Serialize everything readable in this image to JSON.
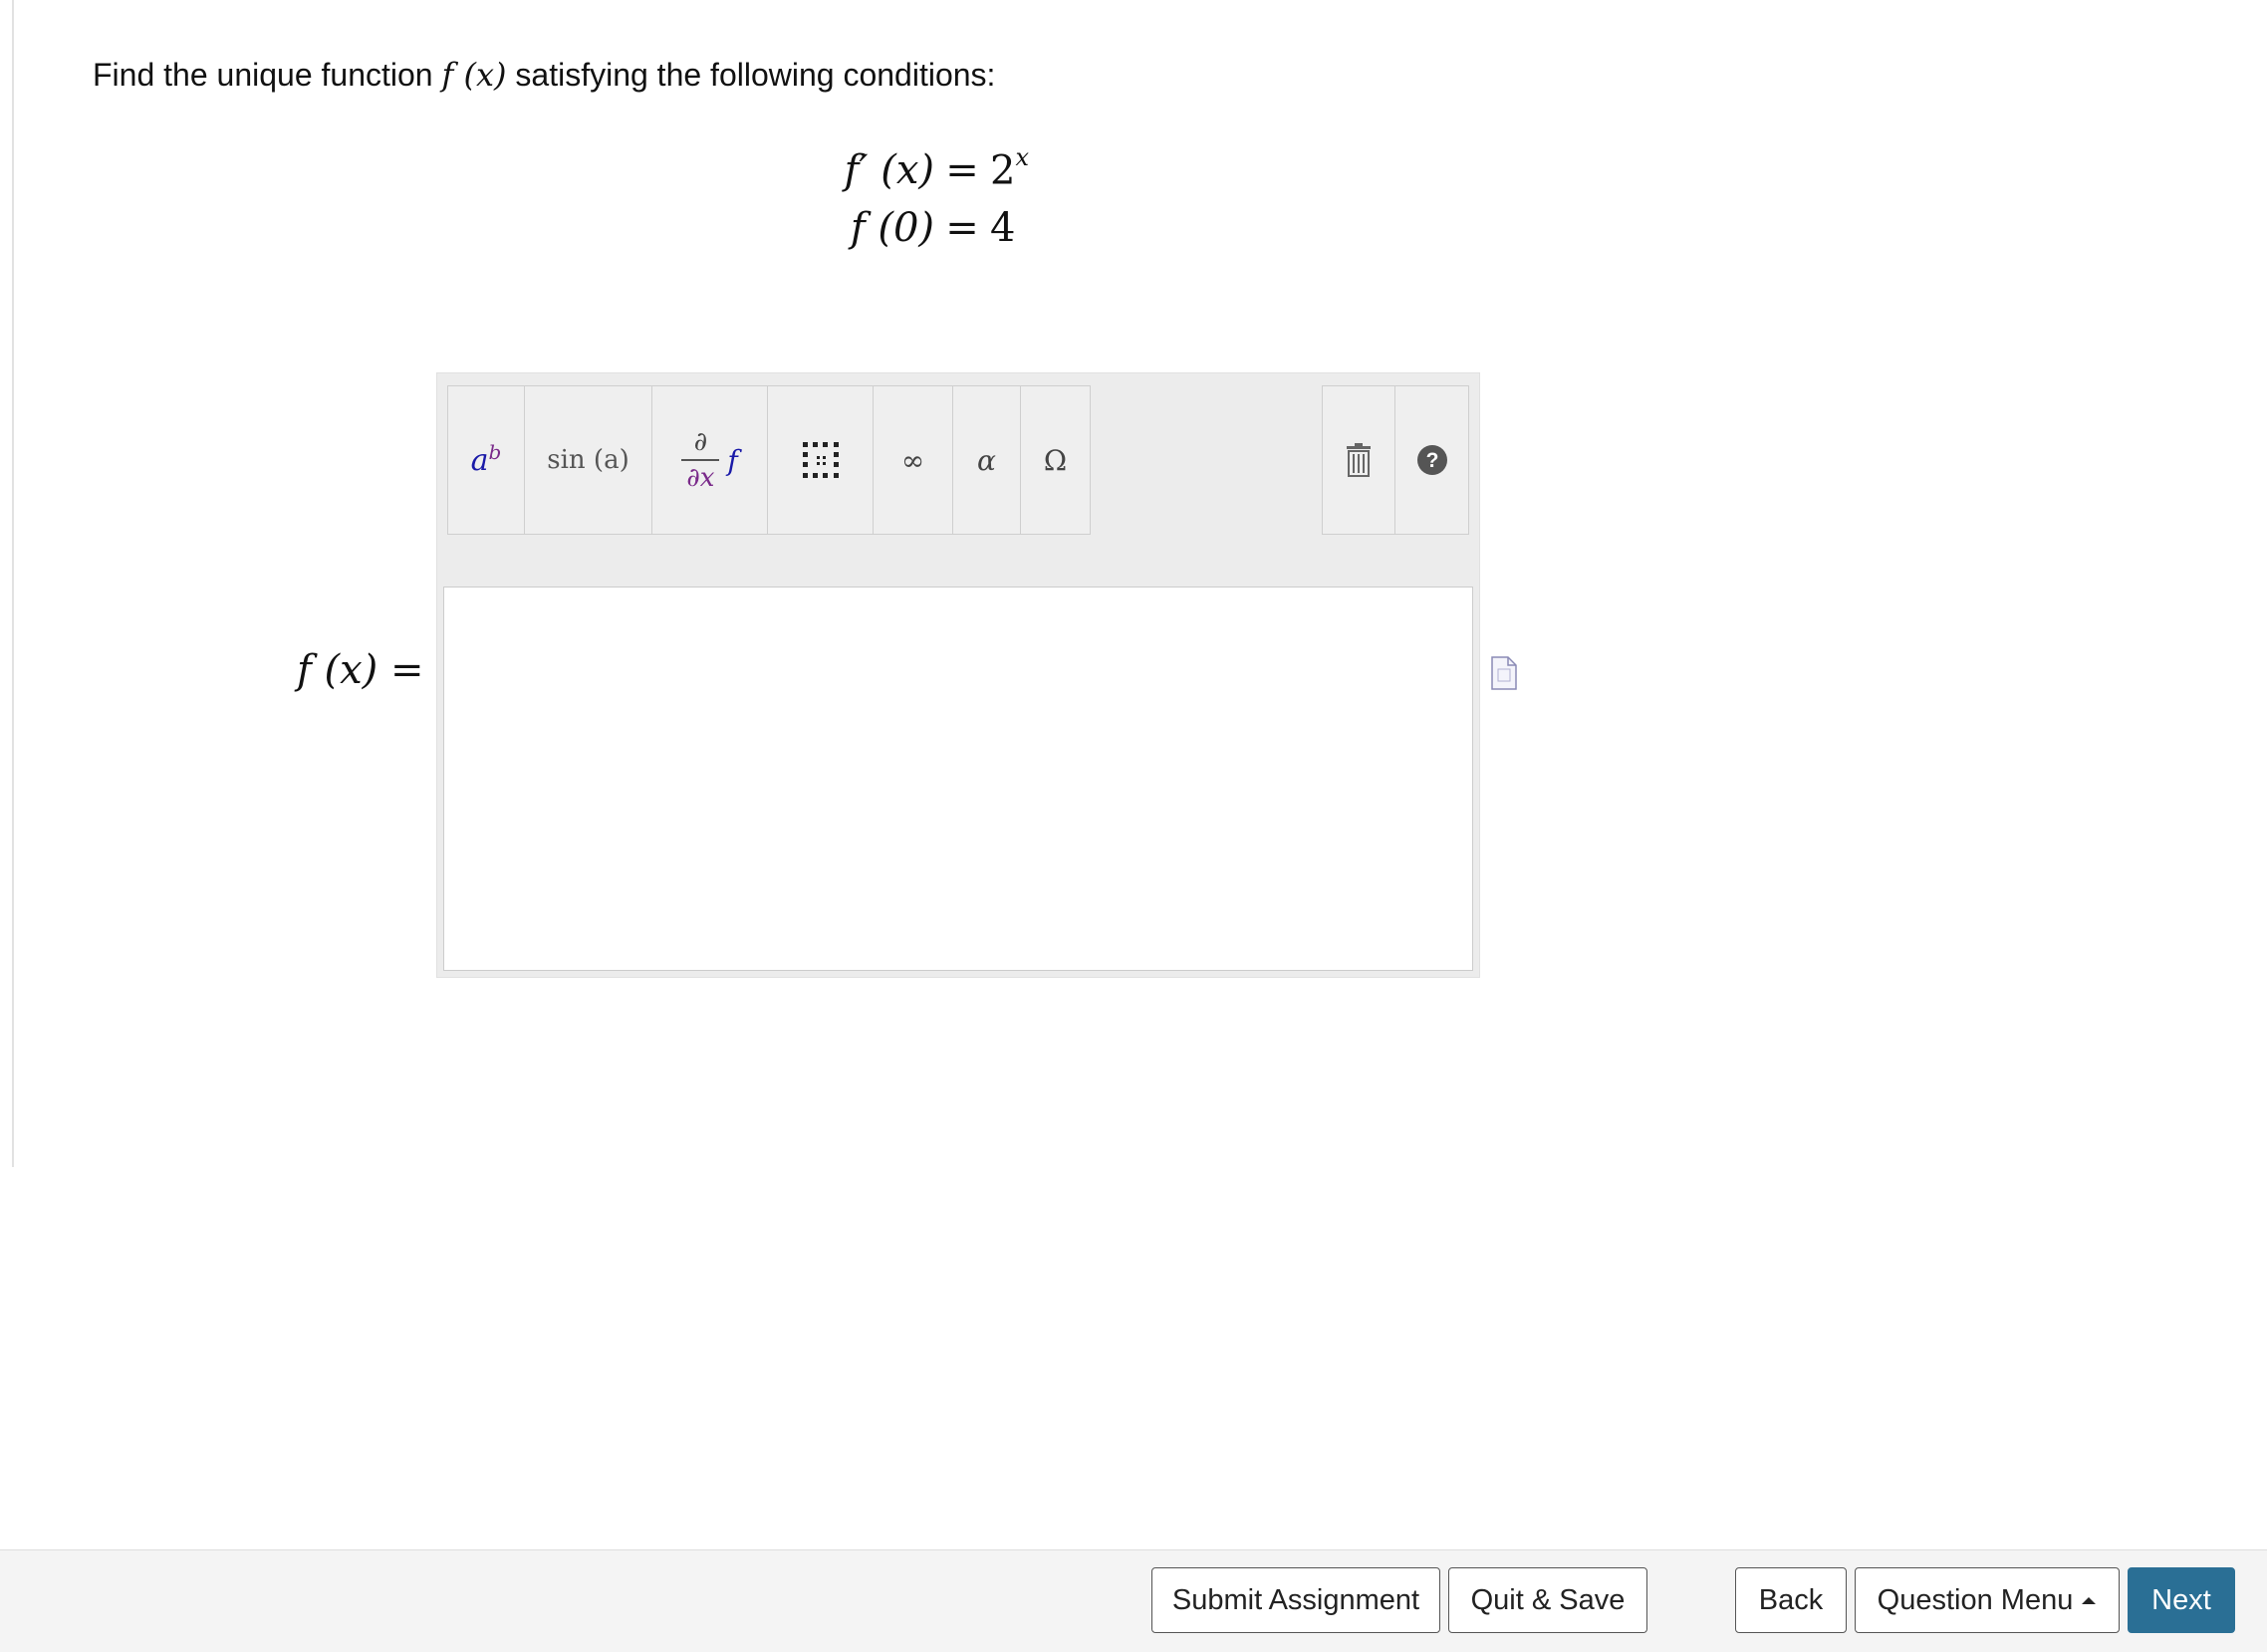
{
  "question": {
    "prompt_before": "Find the unique function ",
    "prompt_math": "f (x)",
    "prompt_after": " satisfying the following conditions:",
    "conditions": [
      {
        "lhs": "f′ (x)",
        "op": "=",
        "rhs_base": "2",
        "rhs_exp": "x"
      },
      {
        "lhs": "f (0)",
        "op": "=",
        "rhs_base": "4",
        "rhs_exp": ""
      }
    ]
  },
  "toolbar": {
    "buttons": [
      {
        "name": "superscript-button",
        "base": "a",
        "exp": "b"
      },
      {
        "name": "function-button",
        "text": "sin (a)"
      },
      {
        "name": "derivative-button",
        "top": "∂",
        "bottom": "∂x",
        "var": "f"
      },
      {
        "name": "matrix-button"
      },
      {
        "name": "infinity-button",
        "text": "∞"
      },
      {
        "name": "greek-button",
        "text": "α"
      },
      {
        "name": "symbol-button",
        "text": "Ω"
      }
    ],
    "right_icons": [
      "trash-icon",
      "help-icon"
    ]
  },
  "answer": {
    "label": "f (x) =",
    "value": ""
  },
  "footer": {
    "submit_label": "Submit Assignment",
    "quit_label": "Quit & Save",
    "back_label": "Back",
    "menu_label": "Question Menu",
    "next_label": "Next"
  },
  "colors": {
    "next_bg": "#2a6f95",
    "toolbar_bg": "#ececec",
    "icon_blue": "#1a1aa8",
    "icon_purple": "#7a2a8a"
  }
}
